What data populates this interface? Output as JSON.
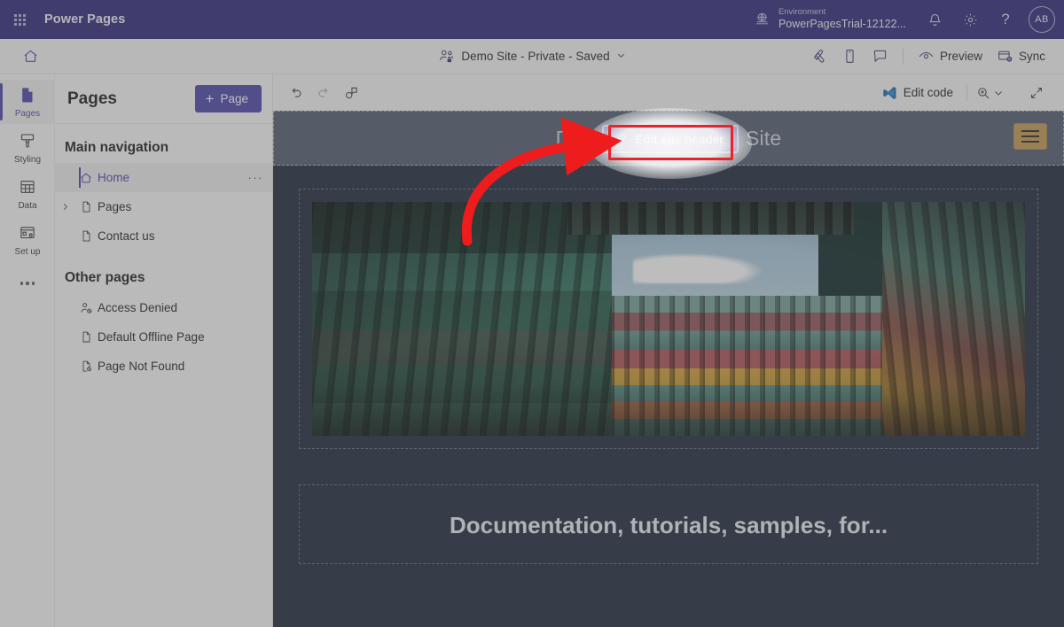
{
  "suite": {
    "waffle_icon": "waffle-grid-icon",
    "app_title": "Power Pages",
    "environment_label": "Environment",
    "environment_name": "PowerPagesTrial-12122...",
    "globe_icon": "environment-globe-icon",
    "notification_icon": "bell-icon",
    "settings_icon": "gear-icon",
    "help_icon": "question-mark-icon",
    "help_glyph": "?",
    "avatar_initials": "AB",
    "bg_color": "#2f2a7c"
  },
  "command_bar": {
    "home_icon": "home-icon",
    "site_icon": "site-visibility-people-lock-icon",
    "site_status": "Demo Site - Private - Saved",
    "chevron": "⌄",
    "themes_icon": "themes-icon",
    "device_preview_icon": "mobile-device-icon",
    "comments_icon": "comment-icon",
    "preview_label": "Preview",
    "preview_icon": "eye-icon",
    "sync_label": "Sync",
    "sync_icon": "sync-icon"
  },
  "rail": {
    "items": [
      {
        "label": "Pages",
        "icon": "pages-icon",
        "selected": true
      },
      {
        "label": "Styling",
        "icon": "paint-brush-icon",
        "selected": false
      },
      {
        "label": "Data",
        "icon": "table-grid-icon",
        "selected": false
      },
      {
        "label": "Set up",
        "icon": "setup-gear-icon",
        "selected": false
      }
    ],
    "overflow_icon": "more-dots-icon"
  },
  "pages_panel": {
    "title": "Pages",
    "add_button_label": "Page",
    "add_button_plus": "+",
    "main_nav_title": "Main navigation",
    "main_nav_items": [
      {
        "label": "Home",
        "icon": "home-icon",
        "selected": true,
        "has_chevron": false,
        "has_more": true
      },
      {
        "label": "Pages",
        "icon": "page-icon",
        "selected": false,
        "has_chevron": true,
        "has_more": false
      },
      {
        "label": "Contact us",
        "icon": "page-icon",
        "selected": false,
        "has_chevron": false,
        "has_more": false
      }
    ],
    "other_pages_title": "Other pages",
    "other_pages_items": [
      {
        "label": "Access Denied",
        "icon": "person-blocked-icon"
      },
      {
        "label": "Default Offline Page",
        "icon": "page-icon"
      },
      {
        "label": "Page Not Found",
        "icon": "page-blocked-icon"
      }
    ],
    "row_more_glyph": "···",
    "accent_color": "#4b47ab"
  },
  "canvas_toolbar": {
    "undo_icon": "undo-icon",
    "redo_icon": "redo-icon",
    "collaborate_icon": "co-presence-icon",
    "edit_code_label": "Edit code",
    "edit_code_icon": "vs-code-icon",
    "zoom_icon": "magnifier-zoom-icon",
    "zoom_chevron": "⌄",
    "fullscreen_icon": "expand-diagonal-icon"
  },
  "site_preview": {
    "header_title": "Demo Power Pages Site",
    "edit_header_button_label": "Edit site header",
    "edit_header_button_icon": "pencil-edit-icon",
    "hamburger_icon": "hamburger-menu-icon",
    "hero_image_alt": "stacked shipping containers viewed from below with sky",
    "bottom_section_text": "Documentation, tutorials, samples, for...",
    "canvas_bg": "#1e2a3d",
    "header_bg": "#525e70"
  },
  "annotation": {
    "arrow_color": "#ee1c1c",
    "highlight_box_color": "#e8242a",
    "halo_shape": "white-ellipse-highlight",
    "target": "edit-site-header-button"
  }
}
